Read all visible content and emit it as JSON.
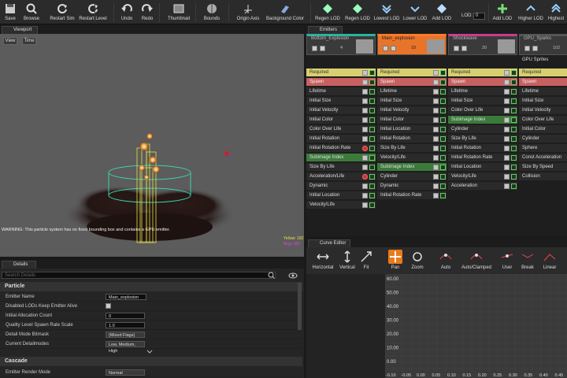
{
  "toolbar": {
    "buttons": [
      {
        "label": "Save",
        "icon": "floppy-icon"
      },
      {
        "label": "Browse",
        "icon": "magnifier-icon"
      },
      {
        "label": "Restart Sim",
        "icon": "restart-icon"
      },
      {
        "label": "Restart Level",
        "icon": "restart-level-icon"
      },
      {
        "label": "Undo",
        "icon": "undo-icon"
      },
      {
        "label": "Redo",
        "icon": "redo-icon"
      },
      {
        "label": "Thumbnail",
        "icon": "thumbnail-icon"
      },
      {
        "label": "Bounds",
        "icon": "bounds-icon"
      },
      {
        "label": "Origin Axis",
        "icon": "axis-icon"
      },
      {
        "label": "Background Color",
        "icon": "palette-icon"
      },
      {
        "label": "Regen LOD",
        "icon": "regen-lod-icon"
      },
      {
        "label": "Regen LOD",
        "icon": "regen-lod-2-icon"
      },
      {
        "label": "Lowest LOD",
        "icon": "lowest-lod-icon"
      },
      {
        "label": "Lower LOD",
        "icon": "lower-lod-icon"
      },
      {
        "label": "Add LOD",
        "icon": "add-lod-icon"
      },
      {
        "label": "Add LOD",
        "icon": "add-lod-2-icon"
      },
      {
        "label": "Higher LOD",
        "icon": "higher-lod-icon"
      },
      {
        "label": "Highest",
        "icon": "highest-lod-icon"
      }
    ],
    "lod_label": "LOD:",
    "lod_value": "0"
  },
  "viewport": {
    "tab": "Viewport",
    "view_btn": "View",
    "time_btn": "Time",
    "warning": "WARNING: This particle system has no fixed bounding box and contains a GPU emitter.",
    "stats_line1": "Yellow: 182",
    "stats_line2": "Mag: 182"
  },
  "emitters": {
    "tab": "Emitters",
    "columns": [
      {
        "name": "Bottom_Explosion",
        "count": "4",
        "type": "",
        "modules": [
          "Required",
          "Spawn",
          "Lifetime",
          "Initial Size",
          "Initial Velocity",
          "Initial Color",
          "Color Over Life",
          "Initial Rotation",
          "Initial Rotation Rate",
          "Subimage Index",
          "Size By Life",
          "Acceleration/Life",
          "Dynamic",
          "Initial Location",
          "Velocity/Life"
        ]
      },
      {
        "name": "Main_explosion",
        "count": "10",
        "type": "",
        "modules": [
          "Required",
          "Spawn",
          "Lifetime",
          "Initial Size",
          "Initial Velocity",
          "Initial Color",
          "Initial Location",
          "Initial Rotation",
          "Size By Life",
          "Velocity/Life",
          "Subimage Index",
          "Cylinder",
          "Dynamic",
          "Initial Rotation Rate"
        ]
      },
      {
        "name": "Shockwave",
        "count": "20",
        "type": "",
        "modules": [
          "Required",
          "Spawn",
          "Lifetime",
          "Initial Size",
          "Color Over Life",
          "Subimage Index",
          "Cylinder",
          "Size By Life",
          "Initial Rotation",
          "Initial Rotation Rate",
          "Initial Location",
          "Velocity/Life",
          "Acceleration"
        ]
      },
      {
        "name": "GPU_Sparks",
        "count": "102",
        "type": "GPU Sprites",
        "modules": [
          "Required",
          "Spawn",
          "Lifetime",
          "Initial Size",
          "Initial Velocity",
          "Color Over Life",
          "Initial Color",
          "Cylinder",
          "Sphere",
          "Const Acceleration",
          "Size By Speed",
          "Collision"
        ]
      }
    ]
  },
  "details": {
    "tab": "Details",
    "search_placeholder": "Search Details",
    "section_particle": "Particle",
    "section_cascade": "Cascade",
    "rows": [
      {
        "key": "Emitter Name",
        "value": "Main_explosion"
      },
      {
        "key": "Disabled LODs Keep Emitter Alive",
        "value": ""
      },
      {
        "key": "Initial Allocation Count",
        "value": "0"
      },
      {
        "key": "Quality Level Spawn Rate Scale",
        "value": "1.0"
      },
      {
        "key": "Detail Mode Bitmask",
        "value": "(Mixed Flags)"
      },
      {
        "key": "Current Detailmodes",
        "value": "Low, Medium, High"
      }
    ],
    "cascade_rows": [
      {
        "key": "Emitter Render Mode",
        "value": "Normal"
      }
    ]
  },
  "curve_editor": {
    "tab": "Curve Editor",
    "buttons": [
      {
        "label": "Horizontal",
        "icon": "horizontal-fit-icon"
      },
      {
        "label": "Vertical",
        "icon": "vertical-fit-icon"
      },
      {
        "label": "Fit",
        "icon": "fit-icon"
      },
      {
        "label": "Pan",
        "icon": "pan-icon"
      },
      {
        "label": "Zoom",
        "icon": "zoom-icon"
      },
      {
        "label": "Auto",
        "icon": "auto-tangent-icon"
      },
      {
        "label": "Auto/Clamped",
        "icon": "auto-clamped-icon"
      },
      {
        "label": "User",
        "icon": "user-tangent-icon"
      },
      {
        "label": "Break",
        "icon": "break-tangent-icon"
      },
      {
        "label": "Linear",
        "icon": "linear-icon"
      }
    ],
    "y_ticks": [
      "60.00",
      "50.00",
      "40.00",
      "30.00",
      "20.00",
      "10.00",
      "0.00"
    ],
    "x_ticks": [
      "-0.10",
      "-0.05",
      "0.00",
      "0.05",
      "0.10",
      "0.15",
      "0.20",
      "0.25",
      "0.30",
      "0.35",
      "0.40",
      "0.45"
    ]
  },
  "colors": {
    "accent": "#e87a1a",
    "required": "#d8d070",
    "spawn": "#c86060",
    "subimage": "#3c7a3c",
    "teal": "#29b4a0",
    "main_hdr": "#e8742a",
    "shock_hdr": "#c83c8c"
  }
}
